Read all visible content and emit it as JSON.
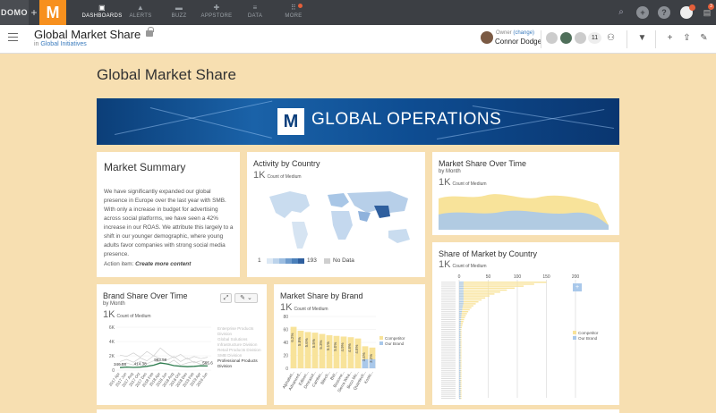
{
  "nav": {
    "logo_text": "DOMO",
    "plus": "+",
    "brand_letter": "M",
    "items": [
      {
        "label": "DASHBOARDS",
        "icon": "dashboards-icon",
        "glyph": "▣",
        "active": true
      },
      {
        "label": "ALERTS",
        "icon": "bell-icon",
        "glyph": "▲",
        "active": false
      },
      {
        "label": "BUZZ",
        "icon": "chat-icon",
        "glyph": "▬",
        "active": false
      },
      {
        "label": "APPSTORE",
        "icon": "appstore-icon",
        "glyph": "✚",
        "active": false
      },
      {
        "label": "DATA",
        "icon": "data-icon",
        "glyph": "≡",
        "active": false
      },
      {
        "label": "MORE",
        "icon": "more-icon",
        "glyph": "⠿",
        "active": false
      }
    ],
    "right": {
      "search_glyph": "⌕",
      "add_glyph": "+",
      "help_glyph": "?",
      "notifications_badge": "3"
    }
  },
  "header": {
    "title": "Global Market Share",
    "breadcrumb_prefix": "in",
    "breadcrumb_link": "Global Initiatives",
    "owner_label": "Owner",
    "owner_change": "(change)",
    "owner_name": "Connor Dodge",
    "shared_count": "11"
  },
  "page": {
    "heading": "Global Market Share",
    "banner_logo": "M",
    "banner_text": "GLOBAL OPERATIONS"
  },
  "cards": {
    "summary": {
      "title": "Market Summary",
      "body": "We have significantly expanded our global presence in Europe over the last year with SMB. With only a  increase in budget for advertising across social platforms, we have seen a 42% increase in our ROAS. We attribute this largely to a shift in our younger demographic, where young adults favor companies with strong social media presence.",
      "action_prefix": "Action item: ",
      "action_link": "Create more content"
    },
    "activity": {
      "title": "Activity by Country",
      "metric": "1K",
      "metric_unit": "Count of Medium",
      "legend_min": "1",
      "legend_max": "193",
      "legend_nodata": "No Data"
    },
    "share_over_time": {
      "title": "Market Share Over Time",
      "subtitle": "by Month",
      "metric": "1K",
      "metric_unit": "Count of Medium"
    },
    "brand_share": {
      "title": "Brand Share Over Time",
      "subtitle": "by Month",
      "metric": "1K",
      "metric_unit": "Count of Medium",
      "expand_glyph": "⤢",
      "tools_glyph": "✎ ⌄",
      "legend_faint": [
        "Enterprise Products Division",
        "Global Solutions",
        "Infrastructure Division",
        "Retail Products Division",
        "SMB Division"
      ],
      "legend_main": "Professional Products Division"
    },
    "share_by_brand": {
      "title": "Market Share by Brand",
      "metric": "1K",
      "metric_unit": "Count of Medium",
      "legend": [
        "Competitor",
        "Our Brand"
      ]
    },
    "share_by_country": {
      "title": "Share of Market by Country",
      "metric": "1K",
      "metric_unit": "Count of Medium",
      "legend": [
        "Competitor",
        "Our Brand"
      ]
    }
  },
  "colors": {
    "page_bg": "#f7dfb1",
    "nav_bg": "#3c3f44",
    "brand_orange": "#f7901e",
    "competitor": "#f8e39a",
    "our_brand": "#a9c8ea",
    "link": "#3a7bbd"
  },
  "chart_data": [
    {
      "type": "line",
      "title": "Brand Share Over Time",
      "y_ticks": [
        "6K",
        "4K",
        "2K",
        "0"
      ],
      "ylim": [
        0,
        6000
      ],
      "x": [
        "2017 Apr",
        "2017 Jun",
        "2017 Aug",
        "2017 Oct",
        "2017 Dec",
        "2018 Feb",
        "2018 Apr",
        "2018 Jun",
        "2018 Aug",
        "2018 Oct",
        "2018 Dec",
        "2019 Feb",
        "2019 Apr",
        "2019 Jun"
      ],
      "series": [
        {
          "name": "Professional Products Division",
          "values": [
            346,
            420,
            380,
            414,
            520,
            690,
            983,
            860,
            620,
            540,
            480,
            520,
            600,
            570
          ],
          "labels": {
            "0": "346.58",
            "3": "414.38",
            "6": "983.58",
            "13": "565.6"
          }
        }
      ]
    },
    {
      "type": "bar",
      "title": "Market Share by Brand",
      "y_ticks": [
        "80",
        "60",
        "40",
        "20",
        "0"
      ],
      "ylim": [
        0,
        80
      ],
      "categories": [
        "Alphabet...",
        "Advanced...",
        "Edison...",
        "Dmirasol...",
        "Camber...",
        "Bitech...",
        "BW...",
        "Biozone...",
        "Sierra Wea...",
        "Beco Mo...",
        "Quantech...",
        "Kosto..."
      ],
      "series": [
        {
          "name": "Competitor",
          "values": [
            64,
            58,
            56,
            55,
            53,
            51,
            50,
            49,
            48,
            46,
            34,
            32
          ]
        },
        {
          "name": "Our Brand",
          "values": [
            0,
            0,
            0,
            0,
            0,
            0,
            0,
            0,
            0,
            0,
            14,
            14
          ]
        }
      ],
      "data_labels": [
        "6.2%",
        "5.8%",
        "5.6%",
        "5.5%",
        "5.3%",
        "5.1%",
        "5.0%",
        "4.9%",
        "4.8%",
        "4.6%",
        "3.4%",
        "3.2%"
      ]
    },
    {
      "type": "bar",
      "title": "Share of Market by Country",
      "orientation": "horizontal",
      "x_ticks": [
        "0",
        "50",
        "100",
        "150",
        "200"
      ],
      "xlim": [
        0,
        200
      ]
    }
  ]
}
